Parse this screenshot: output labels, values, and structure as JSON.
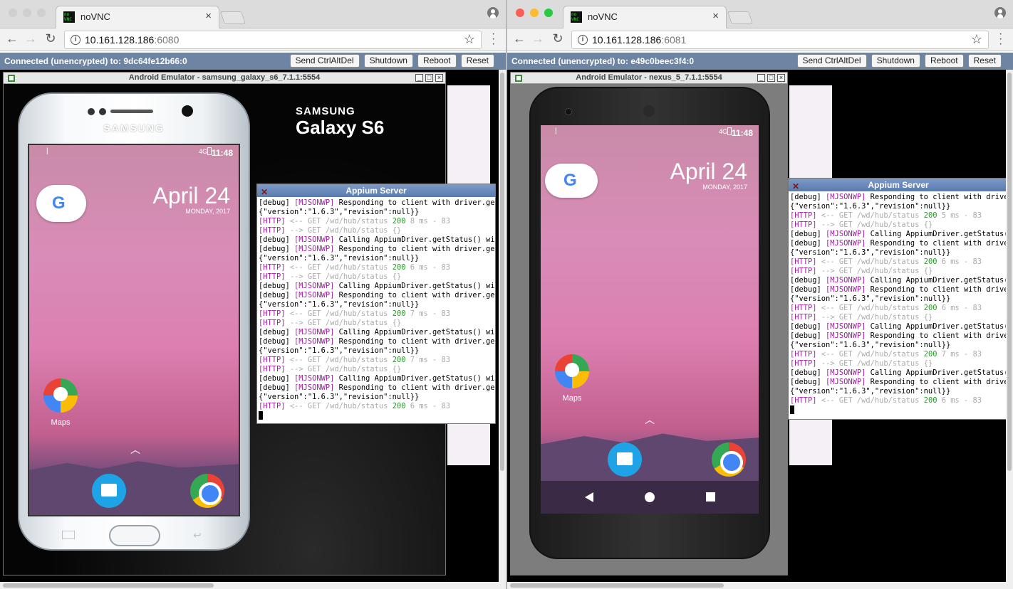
{
  "left": {
    "tab_title": "noVNC",
    "url_host": "10.161.128.186",
    "url_port": ":6080",
    "status": "Connected (unencrypted) to: 9dc64fe12b66:0",
    "buttons": [
      "Send CtrlAltDel",
      "Shutdown",
      "Reboot",
      "Reset"
    ],
    "emulator_title": "Android Emulator - samsung_galaxy_s6_7.1.1:5554",
    "brand_top": "SAMSUNG",
    "brand_bottom": "Galaxy S6",
    "bezel_brand": "SAMSUNG",
    "clock": "11:48",
    "signal": "4G",
    "date": "April 24",
    "weekday": "MONDAY, 2017",
    "maps_label": "Maps",
    "google_g": "G",
    "appium_title": "Appium Server"
  },
  "right": {
    "tab_title": "noVNC",
    "url_host": "10.161.128.186",
    "url_port": ":6081",
    "status": "Connected (unencrypted) to: e49c0beec3f4:0",
    "buttons": [
      "Send CtrlAltDel",
      "Shutdown",
      "Reboot",
      "Reset"
    ],
    "emulator_title": "Android Emulator - nexus_5_7.1.1:5554",
    "clock": "11:48",
    "signal": "4G",
    "date": "April 24",
    "weekday": "MONDAY, 2017",
    "maps_label": "Maps",
    "google_g": "G",
    "appium_title": "Appium Server"
  },
  "colors": {
    "vnc_bar": "#6e84a3",
    "wallpaper_top": "#d98cb8",
    "appium_title": "#5a7bb0"
  }
}
